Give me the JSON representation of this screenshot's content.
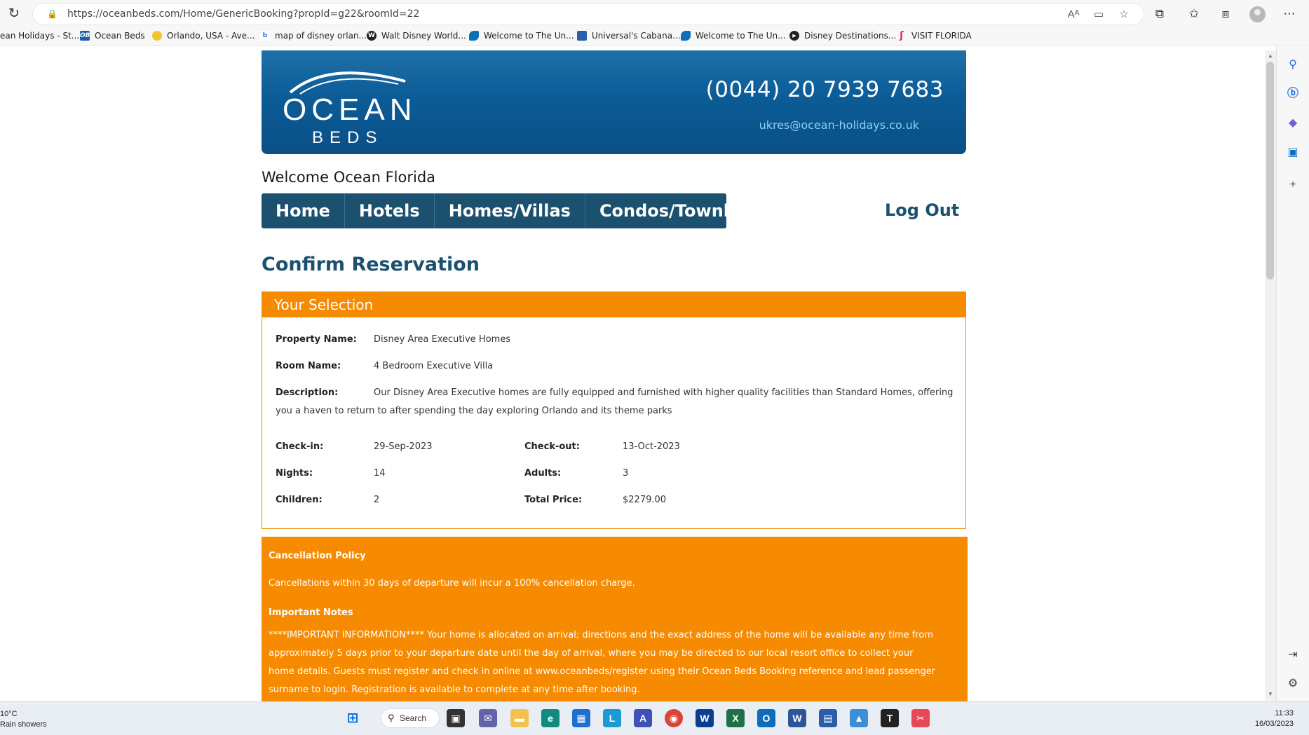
{
  "browser": {
    "url": "https://oceanbeds.com/Home/GenericBooking?propId=g22&roomId=22",
    "bookmarks": [
      {
        "label": "ean Holidays - St...",
        "color": "#ffffff"
      },
      {
        "label": "Ocean Beds",
        "color": "#1f5fa8",
        "fav": "OB"
      },
      {
        "label": "Orlando, USA - Ave...",
        "color": "#f4c430"
      },
      {
        "label": "map of disney orlan...",
        "color": "#1a73e8",
        "fav": "b"
      },
      {
        "label": "Walt Disney World...",
        "color": "#222222",
        "fav": "W"
      },
      {
        "label": "Welcome to The Un...",
        "color": "#0f6fb7"
      },
      {
        "label": "Universal's Cabana...",
        "color": "#2a5ea8"
      },
      {
        "label": "Welcome to The Un...",
        "color": "#0f6fb7"
      },
      {
        "label": "Disney Destinations...",
        "color": "#222222"
      },
      {
        "label": "VISIT FLORIDA",
        "color": "#e0247a"
      }
    ]
  },
  "header": {
    "logo_top": "OCEAN",
    "logo_bottom": "BEDS",
    "phone": "(0044) 20 7939 7683",
    "email": "ukres@ocean-holidays.co.uk"
  },
  "welcome": "Welcome Ocean Florida",
  "nav": {
    "items": [
      "Home",
      "Hotels",
      "Homes/Villas",
      "Condos/Townhomes"
    ],
    "logout": "Log Out"
  },
  "page_title": "Confirm Reservation",
  "selection": {
    "heading": "Your Selection",
    "property_label": "Property Name:",
    "property_value": "Disney Area Executive Homes",
    "room_label": "Room Name:",
    "room_value": "4 Bedroom Executive Villa",
    "description_label": "Description:",
    "description_value": "Our Disney Area Executive homes are fully equipped and furnished with higher quality facilities than Standard Homes, offering you a haven to return to after spending the day exploring Orlando and its theme parks",
    "checkin_label": "Check-in:",
    "checkin_value": "29-Sep-2023",
    "checkout_label": "Check-out:",
    "checkout_value": "13-Oct-2023",
    "nights_label": "Nights:",
    "nights_value": "14",
    "adults_label": "Adults:",
    "adults_value": "3",
    "children_label": "Children:",
    "children_value": "2",
    "total_label": "Total Price:",
    "total_value": "$2279.00"
  },
  "policy": {
    "cancel_heading": "Cancellation Policy",
    "cancel_text": "Cancellations within 30 days of departure will incur a 100% cancellation charge.",
    "notes_heading": "Important Notes",
    "notes_text": "****IMPORTANT INFORMATION**** Your home is allocated on arrival; directions and the exact address of the home will be available any time from approximately 5 days prior to your departure date until the day of arrival, where you may be directed to our local resort office to collect your home details. Guests must register and check in online at www.oceanbeds/register using their Ocean Beds Booking reference and lead passenger surname to login. Registration is available to complete at any time after booking."
  },
  "taskbar": {
    "temp": "10°C",
    "weather": "Rain showers",
    "search_label": "Search",
    "time": "11:33",
    "date": "16/03/2023"
  },
  "colors": {
    "brand_blue": "#0b5c97",
    "nav_blue": "#1b506f",
    "accent_orange": "#f68a00"
  }
}
